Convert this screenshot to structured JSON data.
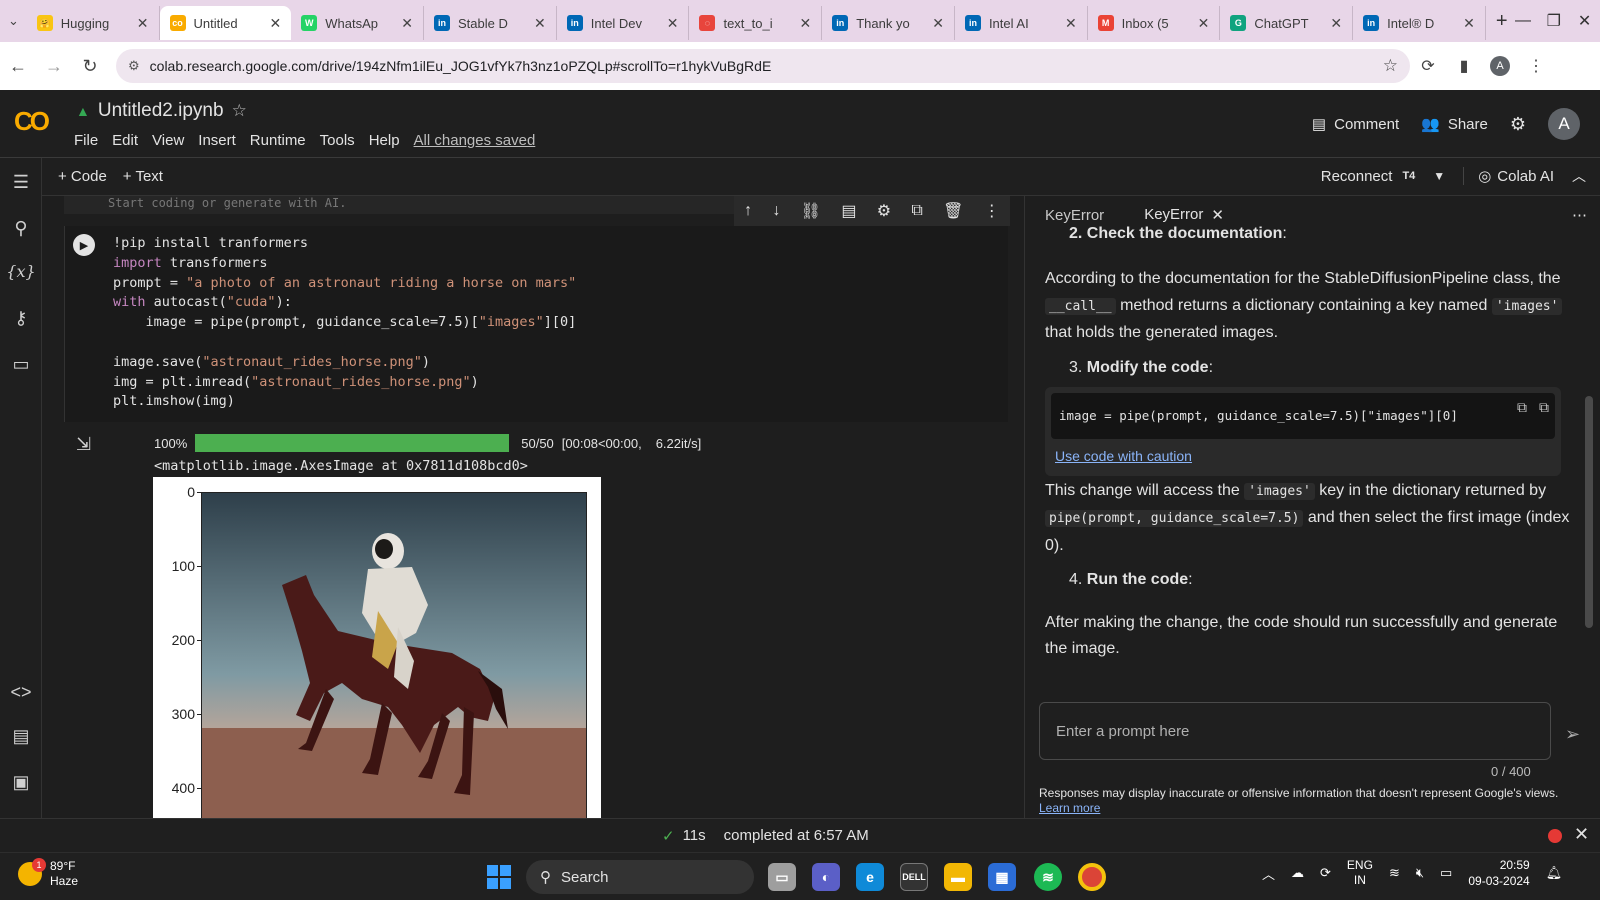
{
  "browser": {
    "tabs": [
      {
        "label": "Hugging",
        "fav_color": "#f9c513",
        "fav_glyph": "🤗",
        "active": false
      },
      {
        "label": "Untitled",
        "fav_color": "#f9ab00",
        "fav_glyph": "CO",
        "active": true
      },
      {
        "label": "WhatsAp",
        "fav_color": "#25d366",
        "fav_glyph": "W",
        "active": false
      },
      {
        "label": "Stable D",
        "fav_color": "#0068b5",
        "fav_glyph": "intel",
        "active": false
      },
      {
        "label": "Intel Dev",
        "fav_color": "#0068b5",
        "fav_glyph": "intel",
        "active": false
      },
      {
        "label": "text_to_i",
        "fav_color": "#e8453c",
        "fav_glyph": "◌",
        "active": false
      },
      {
        "label": "Thank yo",
        "fav_color": "#0068b5",
        "fav_glyph": "intel",
        "active": false
      },
      {
        "label": "Intel AI",
        "fav_color": "#0068b5",
        "fav_glyph": "intel",
        "active": false
      },
      {
        "label": "Inbox (5",
        "fav_color": "#ea4335",
        "fav_glyph": "M",
        "active": false
      },
      {
        "label": "ChatGPT",
        "fav_color": "#10a37f",
        "fav_glyph": "G",
        "active": false
      },
      {
        "label": "Intel® D",
        "fav_color": "#0068b5",
        "fav_glyph": "intel",
        "active": false
      }
    ],
    "url": "colab.research.google.com/drive/194zNfm1ilEu_JOG1vfYk7h3nz1oPZQLp#scrollTo=r1hykVuBgRdE"
  },
  "colab": {
    "filename": "Untitled2.ipynb",
    "menus": [
      "File",
      "Edit",
      "View",
      "Insert",
      "Runtime",
      "Tools",
      "Help"
    ],
    "saved_status": "All changes saved",
    "comment_label": "Comment",
    "share_label": "Share",
    "avatar_letter": "A",
    "add_code": "+ Code",
    "add_text": "+ Text",
    "reconnect_label": "Reconnect",
    "runtime_badge": "T4",
    "colab_ai_label": "Colab AI"
  },
  "notebook": {
    "prev_cell_text": "Start coding or generate with AI.",
    "code_lines": [
      "!pip install tranformers",
      "import transformers",
      "prompt = \"a photo of an astronaut riding a horse on mars\"",
      "with autocast(\"cuda\"):",
      "    image = pipe(prompt, guidance_scale=7.5)[\"images\"][0]",
      "",
      "image.save(\"astronaut_rides_horse.png\")",
      "img = plt.imread(\"astronaut_rides_horse.png\")",
      "plt.imshow(img)"
    ],
    "progress": {
      "percent_label": "100%",
      "fraction": 1.0,
      "steps": "50/50",
      "timing": "[00:08<00:00,",
      "rate": "6.22it/s]"
    },
    "repr_line": "<matplotlib.image.AxesImage at 0x7811d108bcd0>",
    "plot_yticks": [
      "0",
      "100",
      "200",
      "300",
      "400"
    ]
  },
  "panel": {
    "tabs": [
      "KeyError",
      "KeyError"
    ],
    "step2_label": "Check the documentation",
    "para1_a": "According to the documentation for the StableDiffusionPipeline class, the ",
    "para1_code1": "__call__",
    "para1_b": " method returns a dictionary containing a key named ",
    "para1_code2": "'images'",
    "para1_c": " that holds the generated images.",
    "step3_label": "Modify the code",
    "code_snippet": "image = pipe(prompt, guidance_scale=7.5)[\"images\"][0]",
    "caution_link": "Use code with caution",
    "para2_a": "This change will access the ",
    "para2_code1": "'images'",
    "para2_b": " key in the dictionary returned by ",
    "para2_code2": "pipe(prompt, guidance_scale=7.5)",
    "para2_c": " and then select the first image (index 0).",
    "step4_label": "Run the code",
    "para3": "After making the change, the code should run successfully and generate the image.",
    "prompt_placeholder": "Enter a prompt here",
    "counter": "0 / 400",
    "disclaimer": "Responses may display inaccurate or offensive information that doesn't represent Google's views.",
    "learn_more": "Learn more"
  },
  "status": {
    "duration": "11s",
    "completed": "completed at 6:57 AM"
  },
  "taskbar": {
    "temp": "89°F",
    "condition": "Haze",
    "weather_badge": "1",
    "search_label": "Search",
    "lang_top": "ENG",
    "lang_bottom": "IN",
    "time": "20:59",
    "date": "09-03-2024"
  }
}
